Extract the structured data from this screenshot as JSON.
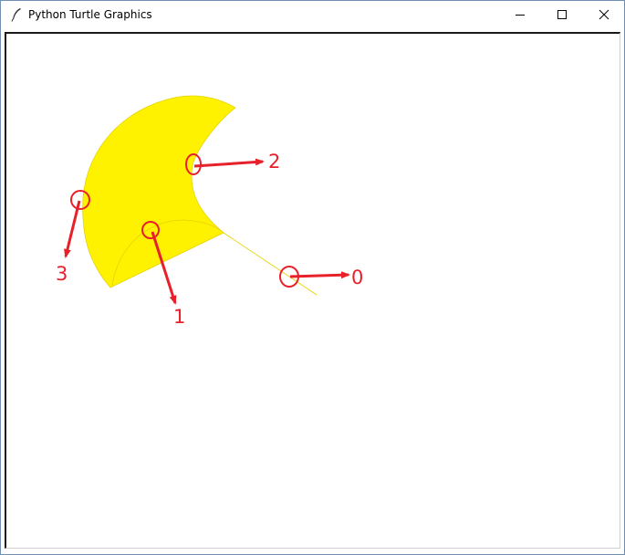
{
  "window": {
    "title": "Python Turtle Graphics",
    "icon": "feather-pen-icon",
    "controls": {
      "minimize": "minimize-icon",
      "maximize": "maximize-icon",
      "close": "close-icon"
    }
  },
  "colors": {
    "fill": "#FFF200",
    "outline": "#E6D200",
    "annotation": "#E8202A"
  },
  "annotations": [
    {
      "id": "marker-0",
      "label": "0"
    },
    {
      "id": "marker-1",
      "label": "1"
    },
    {
      "id": "marker-2",
      "label": "2"
    },
    {
      "id": "marker-3",
      "label": "3"
    }
  ]
}
